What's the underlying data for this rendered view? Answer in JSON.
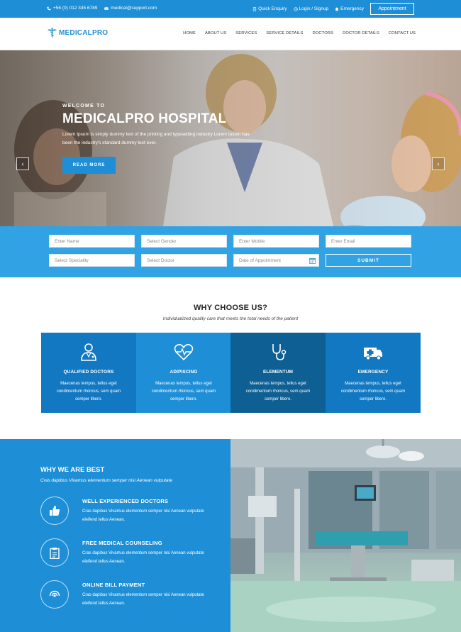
{
  "topbar": {
    "phone": "+56 (0) 012 345 6789",
    "email": "medical@support.com",
    "quick_enquiry": "Quick Enquiry",
    "login_signup": "Login / Signup",
    "emergency": "Emergency",
    "appointment_button": "Appointment"
  },
  "header": {
    "logo_text": "MEDICALPRO",
    "nav": [
      "HOME",
      "ABOUT US",
      "SERVICES",
      "SERVICE DETAILS",
      "DOCTORS",
      "DOCTOR DETAILS",
      "CONTACT US"
    ]
  },
  "hero": {
    "welcome": "WELCOME TO",
    "title": "MEDICALPRO HOSPITAL",
    "description": "Lorem Ipsum is simply dummy text of the printing and typesetting industry Lorem Ipsum has been the industry's standard dummy text ever.",
    "read_more": "READ MORE",
    "prev_arrow": "‹",
    "next_arrow": "›"
  },
  "form": {
    "name_placeholder": "Enter Name",
    "gender_placeholder": "Select Gender",
    "mobile_placeholder": "Enter Mobile",
    "email_placeholder": "Enter Email",
    "speciality_placeholder": "Select Speciality",
    "doctor_placeholder": "Select Doctor",
    "date_placeholder": "Date of Appointment",
    "submit": "SUBMIT"
  },
  "why_choose": {
    "title": "WHY CHOOSE US?",
    "subtitle": "Individualized quality care that meets the total needs of the patient",
    "features": [
      {
        "title": "QUALIFIED DOCTORS",
        "text": "Maecenas tempus, tellus eget condimentum rhoncus, sem quam semper libero.",
        "icon": "doctor-icon",
        "color": "#1278c2"
      },
      {
        "title": "ADIPISCING",
        "text": "Maecenas tempus, tellus eget condimentum rhoncus, sem quam semper libero.",
        "icon": "heart-pulse-icon",
        "color": "#1e8fd6"
      },
      {
        "title": "ELEMENTUM",
        "text": "Maecenas tempus, tellus eget condimentum rhoncus, sem quam semper libero.",
        "icon": "stethoscope-icon",
        "color": "#0e5f93"
      },
      {
        "title": "EMERGENCY",
        "text": "Maecenas tempus, tellus eget condimentum rhoncus, sem quam semper libero.",
        "icon": "ambulance-icon",
        "color": "#1278c2"
      }
    ]
  },
  "best": {
    "title": "WHY WE ARE BEST",
    "subtitle": "Cras dapibus Vivamus elementum semper nisi Aenean vulputate",
    "items": [
      {
        "title": "WELL EXPERIENCED DOCTORS",
        "text": "Cras dapibus Vivamus elementum semper nisi Aenean vulputate eleifend tellus Aenean.",
        "icon": "thumbs-up-icon"
      },
      {
        "title": "FREE MEDICAL COUNSELING",
        "text": "Cras dapibus Vivamus elementum semper nisi Aenean vulputate eleifend tellus Aenean.",
        "icon": "clipboard-icon"
      },
      {
        "title": "ONLINE BILL PAYMENT",
        "text": "Cras dapibus Vivamus elementum semper nisi Aenean vulputate eleifend tellus Aenean.",
        "icon": "signal-icon"
      }
    ]
  },
  "colors": {
    "primary": "#1e8fd6",
    "form_band": "#31a3e4",
    "dark_blue": "#0e5f93"
  }
}
